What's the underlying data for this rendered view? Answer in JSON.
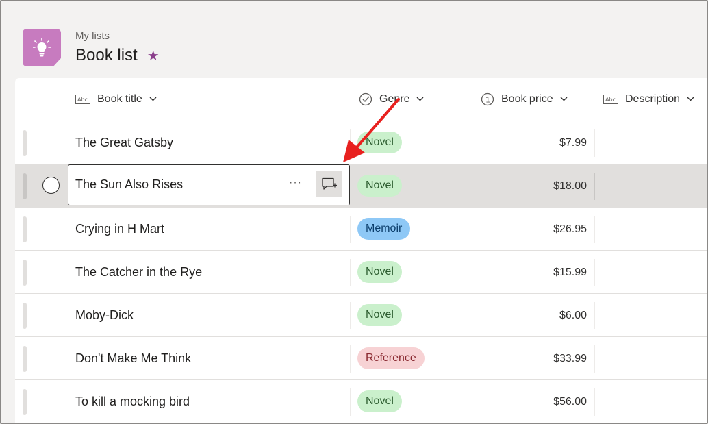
{
  "header": {
    "breadcrumb": "My lists",
    "title": "Book list",
    "favorite_icon": "star-icon",
    "app_icon": "lightbulb-icon",
    "app_color": "#c77bbf"
  },
  "columns": [
    {
      "label": "Book title",
      "icon": "text-abc-icon"
    },
    {
      "label": "Genre",
      "icon": "choice-check-icon"
    },
    {
      "label": "Book price",
      "icon": "number-icon"
    },
    {
      "label": "Description",
      "icon": "text-abc-icon"
    }
  ],
  "rows": [
    {
      "title": "The Great Gatsby",
      "genre": "Novel",
      "price": "$7.99"
    },
    {
      "title": "The Sun Also Rises",
      "genre": "Novel",
      "price": "$18.00"
    },
    {
      "title": "Crying in H Mart",
      "genre": "Memoir",
      "price": "$26.95"
    },
    {
      "title": "The Catcher in the Rye",
      "genre": "Novel",
      "price": "$15.99"
    },
    {
      "title": "Moby-Dick",
      "genre": "Novel",
      "price": "$6.00"
    },
    {
      "title": "Don't Make Me Think",
      "genre": "Reference",
      "price": "$33.99"
    },
    {
      "title": "To kill a mocking bird",
      "genre": "Novel",
      "price": "$56.00"
    }
  ],
  "genre_colors": {
    "Novel": {
      "bg": "#caf0cc",
      "fg": "#2b5b2e"
    },
    "Memoir": {
      "bg": "#8ec8f6",
      "fg": "#0b3d6b"
    },
    "Reference": {
      "bg": "#f7d2d4",
      "fg": "#8a2a31"
    }
  },
  "selected_row": 1,
  "annotation_color": "#e8211f"
}
